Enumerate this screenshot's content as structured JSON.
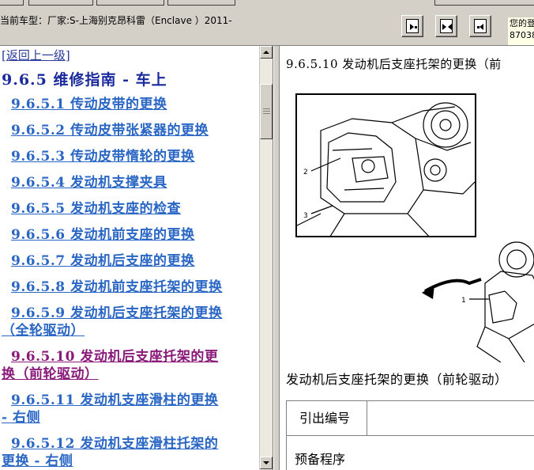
{
  "header": {
    "vehicle_label": "当前车型：厂家:S-上海别克昂科雷（Enclave ）2011-",
    "nav_buttons": [
      {
        "icon": "collapse-tree-icon",
        "glyph": "▸•"
      },
      {
        "icon": "split-view-icon",
        "glyph": "▸◂"
      },
      {
        "icon": "expand-tree-icon",
        "glyph": "◂•"
      }
    ],
    "user_info_line1": "您的登",
    "user_info_line2": "87038"
  },
  "sidebar": {
    "back_label": "[返回上一级]",
    "section_title": "9.6.5 维修指南 - 车上",
    "items": [
      {
        "label": "9.6.5.1 传动皮带的更换",
        "cont": ""
      },
      {
        "label": "9.6.5.2 传动皮带张紧器的更换",
        "cont": ""
      },
      {
        "label": "9.6.5.3 传动皮带惰轮的更换",
        "cont": ""
      },
      {
        "label": "9.6.5.4 发动机支撑夹具",
        "cont": ""
      },
      {
        "label": "9.6.5.5 发动机支座的检查",
        "cont": ""
      },
      {
        "label": "9.6.5.6 发动机前支座的更换",
        "cont": ""
      },
      {
        "label": "9.6.5.7 发动机后支座的更换",
        "cont": ""
      },
      {
        "label": "9.6.5.8 发动机前支座托架的更换",
        "cont": ""
      },
      {
        "label": "9.6.5.9 发动机后支座托架的更换",
        "cont": "（全轮驱动）"
      },
      {
        "label": "9.6.5.10 发动机后支座托架的更",
        "cont": "换（前轮驱动）"
      },
      {
        "label": "9.6.5.11 发动机支座滑柱的更换",
        "cont": "- 右侧"
      },
      {
        "label": "9.6.5.12 发动机支座滑柱托架的",
        "cont": "更换 - 右侧"
      }
    ]
  },
  "content": {
    "heading": "9.6.5.10 发动机后支座托架的更换（前",
    "figure_callouts": [
      "1",
      "2",
      "3"
    ],
    "procedure_title": "发动机后支座托架的更换（前轮驱动）",
    "table_header": "引出编号",
    "prep_label": "预备程序"
  },
  "colors": {
    "link": "#2a66c4",
    "visited_link": "#8a1a7a",
    "title": "#1a2a9c",
    "chrome": "#d4d0c8"
  }
}
